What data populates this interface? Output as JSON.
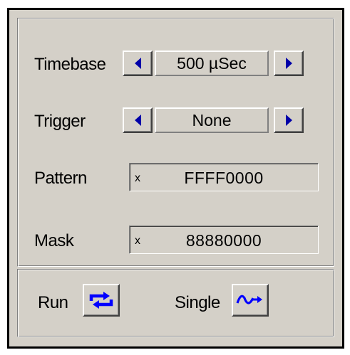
{
  "controls": {
    "timebase": {
      "label": "Timebase",
      "value": "500 µSec"
    },
    "trigger": {
      "label": "Trigger",
      "value": "None"
    },
    "pattern": {
      "label": "Pattern",
      "prefix": "x",
      "value": "FFFF0000"
    },
    "mask": {
      "label": "Mask",
      "prefix": "x",
      "value": "88880000"
    }
  },
  "actions": {
    "run": {
      "label": "Run",
      "icon": "repeat-loop-icon"
    },
    "single": {
      "label": "Single",
      "icon": "single-wave-icon"
    }
  },
  "colors": {
    "panel": "#d4d0c8",
    "icon_blue": "#0000ff",
    "arrow_blue": "#0000a8"
  }
}
